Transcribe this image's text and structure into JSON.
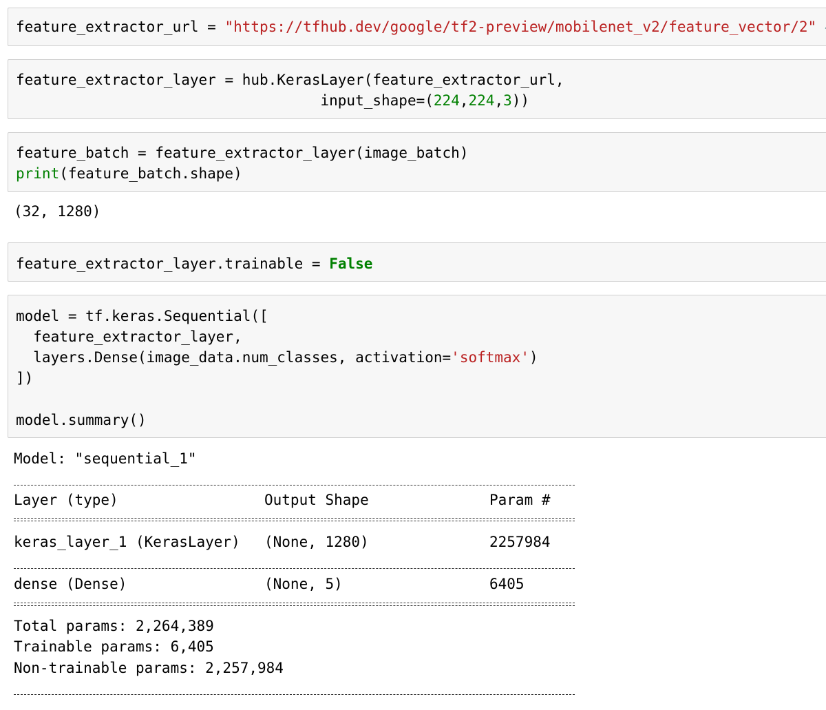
{
  "cells": [
    {
      "tokens": {
        "var": "feature_extractor_url",
        "eq": " = ",
        "str": "\"https://tfhub.dev/google/tf2-preview/mobilenet_v2/feature_vector/2\"",
        "comment": " #"
      }
    },
    {
      "line1": {
        "prefix": "feature_extractor_layer ",
        "eq": "=",
        "suffix": " hub.KerasLayer(feature_extractor_url,"
      },
      "line2": {
        "indent": "                                   input_shape",
        "eq": "=",
        "open": "(",
        "n1": "224",
        "c1": ",",
        "n2": "224",
        "c2": ",",
        "n3": "3",
        "close": "))"
      }
    },
    {
      "line1": {
        "prefix": "feature_batch ",
        "eq": "=",
        "suffix": " feature_extractor_layer(image_batch)"
      },
      "line2": {
        "builtin": "print",
        "rest": "(feature_batch.shape)"
      },
      "output": "(32, 1280)"
    },
    {
      "line1": {
        "prefix": "feature_extractor_layer.trainable ",
        "eq": "=",
        "space": " ",
        "kw": "False"
      }
    },
    {
      "line1": {
        "prefix": "model ",
        "eq": "=",
        "suffix": " tf.keras.Sequential(["
      },
      "line2": "  feature_extractor_layer,",
      "line3": {
        "prefix": "  layers.Dense(image_data.num_classes, activation",
        "eq": "=",
        "str": "'softmax'",
        "suffix": ")"
      },
      "line4": "])",
      "line5": "",
      "line6": "model.summary()"
    }
  ],
  "summary": {
    "model_line": "Model: \"sequential_1\"",
    "headers": {
      "layer": "Layer (type)",
      "output": "Output Shape",
      "param": "Param #"
    },
    "rows": [
      {
        "layer": "keras_layer_1 (KerasLayer)",
        "output": "(None, 1280)",
        "param": "2257984"
      },
      {
        "layer": "dense (Dense)",
        "output": "(None, 5)",
        "param": "6405"
      }
    ],
    "totals": {
      "total": "Total params: 2,264,389",
      "trainable": "Trainable params: 6,405",
      "non_trainable": "Non-trainable params: 2,257,984"
    }
  }
}
